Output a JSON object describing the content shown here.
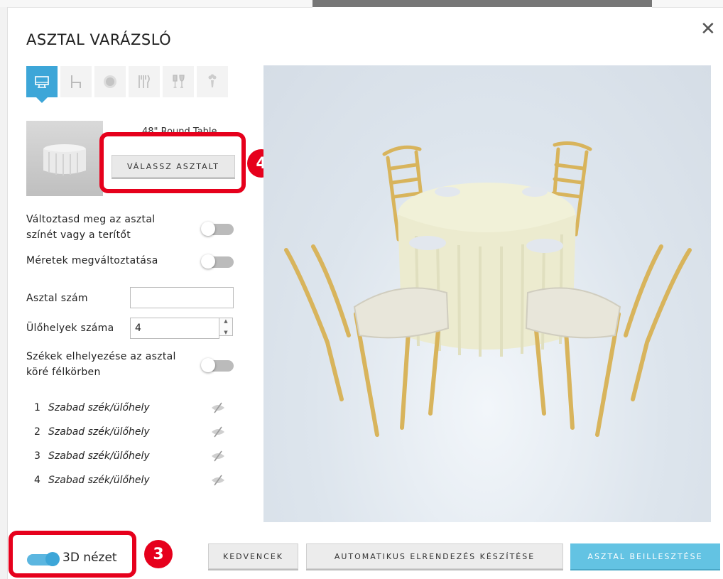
{
  "window": {
    "title": "ASZTAL VARÁZSLÓ",
    "close_icon": "close-icon"
  },
  "tabs": [
    {
      "icon": "table-icon",
      "active": true
    },
    {
      "icon": "chair-icon",
      "active": false
    },
    {
      "icon": "plate-icon",
      "active": false
    },
    {
      "icon": "cutlery-icon",
      "active": false
    },
    {
      "icon": "glasses-icon",
      "active": false
    },
    {
      "icon": "centerpiece-icon",
      "active": false
    }
  ],
  "table_select": {
    "current_label": "48\" Round Table",
    "button_label": "VÁLASSZ ASZTALT",
    "annotation": "4"
  },
  "options": {
    "color_toggle_label_line1": "Változtasd meg az asztal",
    "color_toggle_label_line2": "színét vagy a terítőt",
    "resize_toggle_label": "Méretek megváltoztatása",
    "table_number_label": "Asztal szám",
    "table_number_value": "",
    "seats_label": "Ülőhelyek száma",
    "seats_value": "4",
    "half_circle_label_line1": "Székek elhelyezése az asztal",
    "half_circle_label_line2": "köré félkörben"
  },
  "seats": [
    {
      "num": "1",
      "label": "Szabad szék/ülőhely"
    },
    {
      "num": "2",
      "label": "Szabad szék/ülőhely"
    },
    {
      "num": "3",
      "label": "Szabad szék/ülőhely"
    },
    {
      "num": "4",
      "label": "Szabad szék/ülőhely"
    }
  ],
  "footer": {
    "view3d_label": "3D nézet",
    "view3d_on": true,
    "view3d_annotation": "3",
    "favorites_label": "KEDVENCEK",
    "auto_layout_label": "AUTOMATIKUS ELRENDEZÉS KÉSZÍTÉSE",
    "insert_label": "ASZTAL BEILLESZTÉSE"
  },
  "colors": {
    "accent": "#3da6d8",
    "primary_button": "#63c3e3",
    "annotation_red": "#e6001c",
    "chair_gold": "#d8b45c",
    "tablecloth": "#f1f1d8"
  }
}
